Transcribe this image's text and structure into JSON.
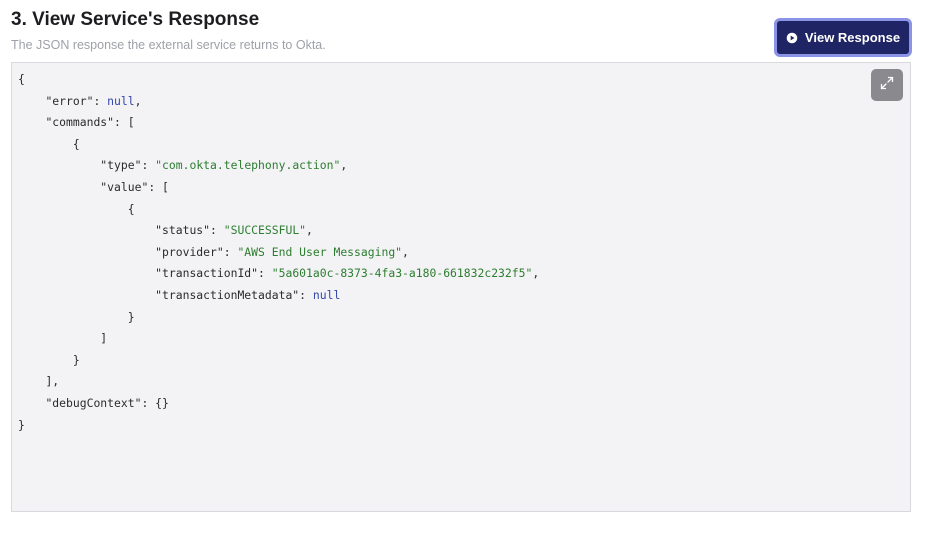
{
  "section": {
    "title": "3. View Service's Response",
    "subtitle": "The JSON response the external service returns to Okta."
  },
  "actions": {
    "view_response_label": "View Response",
    "view_response_icon": "play-circle-icon",
    "expand_icon": "expand-icon"
  },
  "colors": {
    "button_bg": "#1e2464",
    "button_ring": "#8b93e6",
    "code_bg": "#f3f3f6",
    "string": "#2d7d2f",
    "literal": "#3346a8"
  },
  "code_lines": {
    "l01": {
      "indent": "",
      "open": "{"
    },
    "l02": {
      "indent": "    ",
      "key": "\"error\"",
      "sep": ": ",
      "lit": "null",
      "end": ","
    },
    "l03": {
      "indent": "    ",
      "key": "\"commands\"",
      "sep": ": ",
      "open": "["
    },
    "l04": {
      "indent": "        ",
      "open": "{"
    },
    "l05": {
      "indent": "            ",
      "key": "\"type\"",
      "sep": ": ",
      "str": "\"com.okta.telephony.action\"",
      "end": ","
    },
    "l06": {
      "indent": "            ",
      "key": "\"value\"",
      "sep": ": ",
      "open": "["
    },
    "l07": {
      "indent": "                ",
      "open": "{"
    },
    "l08": {
      "indent": "                    ",
      "key": "\"status\"",
      "sep": ": ",
      "str": "\"SUCCESSFUL\"",
      "end": ","
    },
    "l09": {
      "indent": "                    ",
      "key": "\"provider\"",
      "sep": ": ",
      "str": "\"AWS End User Messaging\"",
      "end": ","
    },
    "l10": {
      "indent": "                    ",
      "key": "\"transactionId\"",
      "sep": ": ",
      "str": "\"5a601a0c-8373-4fa3-a180-661832c232f5\"",
      "end": ","
    },
    "l11": {
      "indent": "                    ",
      "key": "\"transactionMetadata\"",
      "sep": ": ",
      "lit": "null"
    },
    "l12": {
      "indent": "                ",
      "open": "}"
    },
    "l13": {
      "indent": "            ",
      "open": "]"
    },
    "l14": {
      "indent": "        ",
      "open": "}"
    },
    "l15": {
      "indent": "    ",
      "open": "],"
    },
    "l16": {
      "indent": "    ",
      "key": "\"debugContext\"",
      "sep": ": ",
      "open": "{}"
    },
    "l17": {
      "indent": "",
      "open": "}"
    }
  }
}
